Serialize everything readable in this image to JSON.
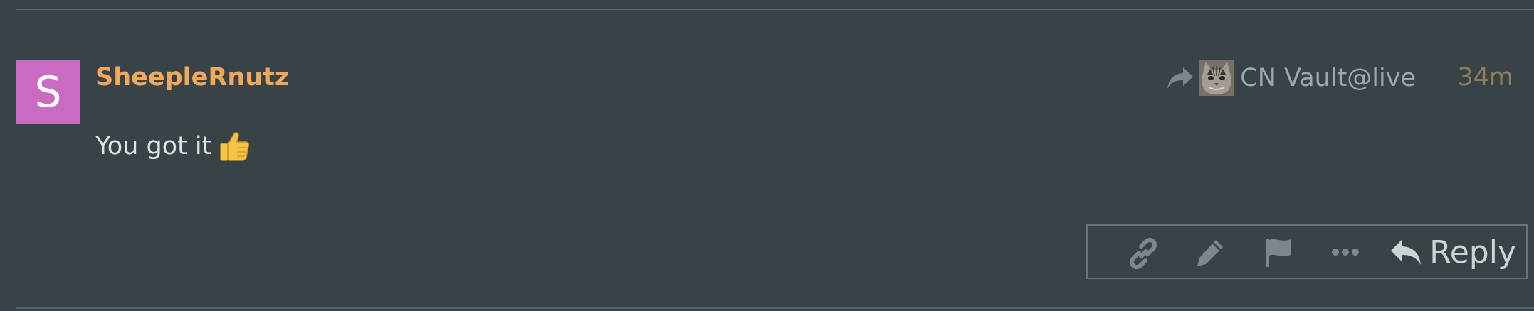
{
  "post": {
    "avatar_letter": "S",
    "username": "SheepleRnutz",
    "reply_to_name": "CN Vault@live",
    "date": "34m",
    "body_text": "You got it",
    "body_emoji": "thumbs-up",
    "controls": {
      "copy_link_icon": "link-icon",
      "edit_icon": "pencil-icon",
      "flag_icon": "flag-icon",
      "more_icon": "ellipsis-icon",
      "reply_label": "Reply"
    }
  },
  "colors": {
    "background": "#384348",
    "avatar_bg": "#c96bc0",
    "username": "#f0a85b",
    "date": "#8e7f58",
    "icon_gray": "#7d878b",
    "text": "#dfe3e4"
  }
}
